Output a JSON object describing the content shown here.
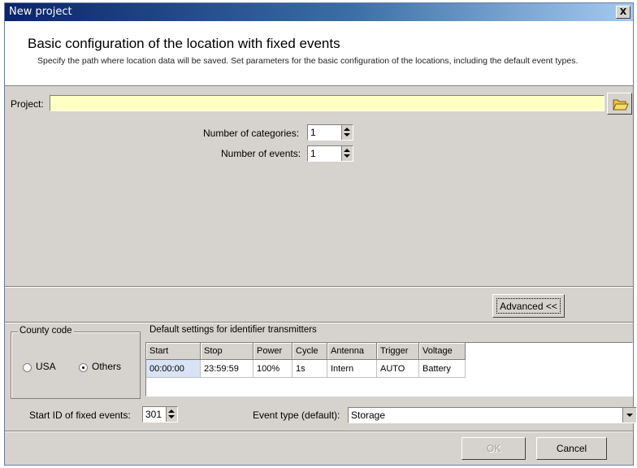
{
  "window": {
    "title": "New project",
    "close_glyph": "X"
  },
  "header": {
    "heading": "Basic configuration of the location with fixed events",
    "description": "Specify the path where location data will be saved. Set parameters for the basic configuration of the locations, including the default event types."
  },
  "project": {
    "label": "Project:",
    "value": ""
  },
  "categories": {
    "label": "Number of categories:",
    "value": "1"
  },
  "events": {
    "label": "Number of events:",
    "value": "1"
  },
  "advanced_label": "Advanced <<",
  "country": {
    "legend": "County code",
    "options": [
      {
        "label": "USA",
        "checked": false
      },
      {
        "label": "Others",
        "checked": true
      }
    ]
  },
  "defaults": {
    "legend": "Default settings for identifier transmitters",
    "columns": [
      "Start",
      "Stop",
      "Power",
      "Cycle",
      "Antenna",
      "Trigger",
      "Voltage"
    ],
    "rows": [
      [
        "00:00:00",
        "23:59:59",
        "100%",
        "1s",
        "Intern",
        "AUTO",
        "Battery"
      ]
    ]
  },
  "start_id": {
    "label": "Start ID of fixed events:",
    "value": "301"
  },
  "event_type": {
    "label": "Event type (default):",
    "value": "Storage"
  },
  "buttons": {
    "ok": "OK",
    "cancel": "Cancel"
  },
  "colors": {
    "title_bar": "#0a246a",
    "input_highlight": "#ffffc4",
    "dialog_face": "#d6d3ce"
  },
  "icons": {
    "folder": "folder-open-icon"
  }
}
